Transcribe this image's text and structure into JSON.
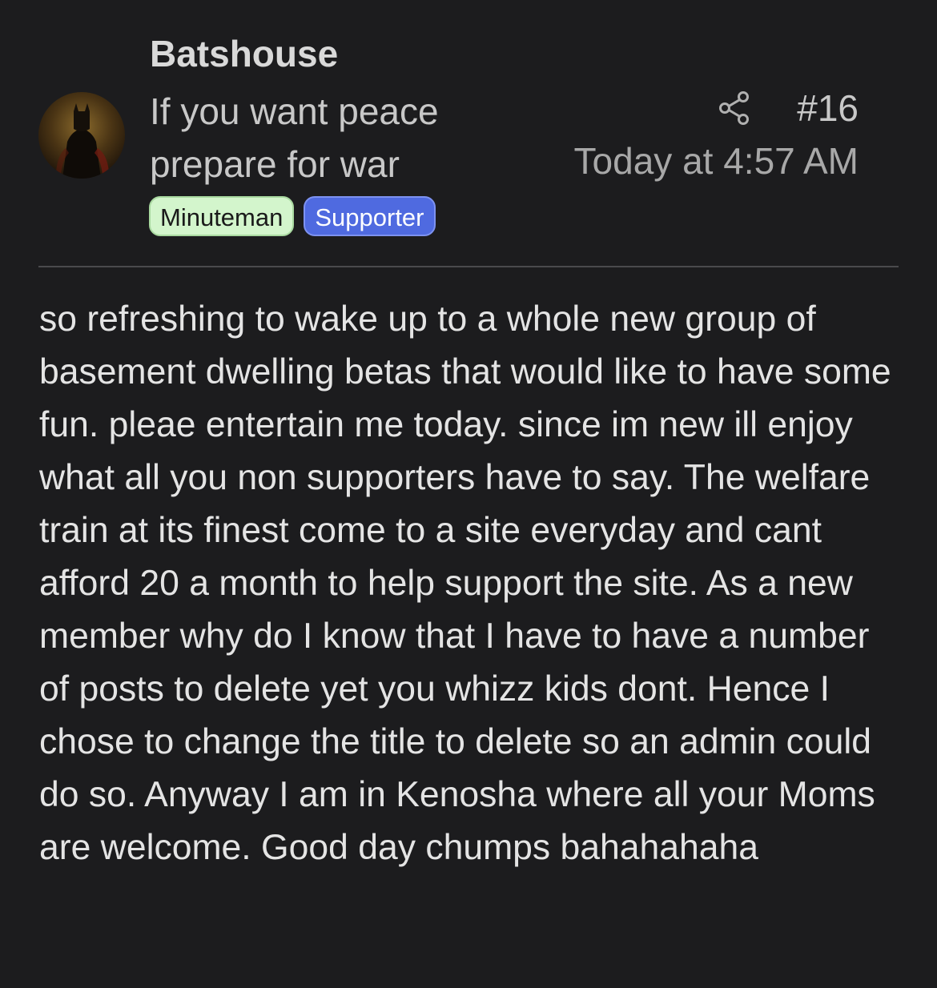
{
  "post": {
    "author": {
      "username": "Batshouse",
      "user_title": "If you want peace prepare for war",
      "avatar_icon": "batman-avatar-icon",
      "badges": [
        {
          "label": "Minuteman",
          "color": "#d3f5cc"
        },
        {
          "label": "Supporter",
          "color": "#4f6ae0"
        }
      ]
    },
    "share_icon": "share-icon",
    "post_number": "#16",
    "timestamp": "Today at 4:57 AM",
    "body": "so refreshing to wake up to a whole new group of basement dwelling betas that would like to have some fun. pleae entertain me today. since im new ill enjoy what all you non supporters have to say. The welfare train at its finest come to a site everyday and cant afford 20 a month to help support the site. As a new member why do I know that I have to have a number of posts to delete yet you whizz kids dont. Hence I chose to change the title to delete so an admin could do so. Anyway I am in Kenosha where all your Moms are welcome. Good day chumps bahahahaha"
  }
}
